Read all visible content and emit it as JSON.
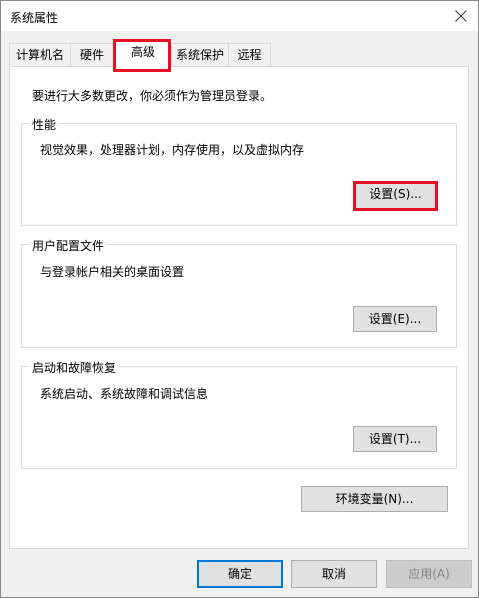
{
  "window": {
    "title": "系统属性"
  },
  "tabs": [
    {
      "label": "计算机名"
    },
    {
      "label": "硬件"
    },
    {
      "label": "高级"
    },
    {
      "label": "系统保护"
    },
    {
      "label": "远程"
    }
  ],
  "active_tab": "高级",
  "intro_text": "要进行大多数更改，你必须作为管理员登录。",
  "groups": {
    "performance": {
      "title": "性能",
      "description": "视觉效果，处理器计划，内存使用，以及虚拟内存",
      "button": "设置(S)..."
    },
    "user_profiles": {
      "title": "用户配置文件",
      "description": "与登录帐户相关的桌面设置",
      "button": "设置(E)..."
    },
    "startup_recovery": {
      "title": "启动和故障恢复",
      "description": "系统启动、系统故障和调试信息",
      "button": "设置(T)..."
    }
  },
  "env_button": "环境变量(N)...",
  "footer": {
    "ok": "确定",
    "cancel": "取消",
    "apply": "应用(A)"
  },
  "colors": {
    "highlight": "#e81123",
    "accent": "#0078d7"
  },
  "icons": {
    "close": "close-icon"
  }
}
